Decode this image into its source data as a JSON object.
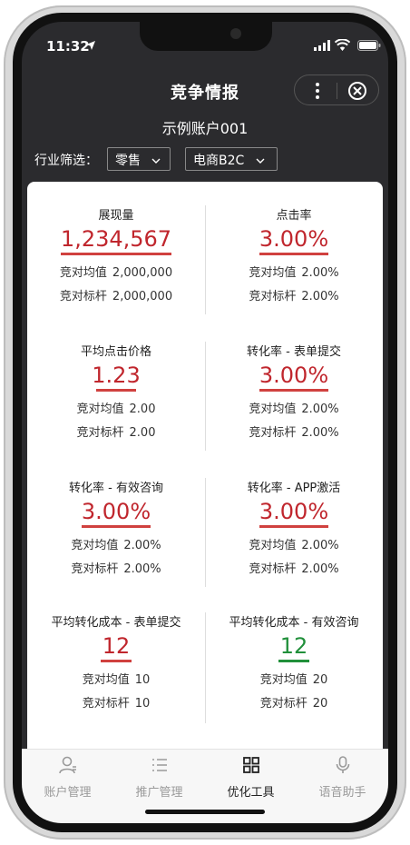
{
  "status_bar": {
    "time": "11:32"
  },
  "header": {
    "title": "竞争情报",
    "account": "示例账户001",
    "filter_label": "行业筛选：",
    "industry_value": "零售",
    "sub_value": "电商B2C"
  },
  "metrics": [
    {
      "title": "展现量",
      "value": "1,234,567",
      "avg_label": "竞对均值",
      "avg": "2,000,000",
      "bench_label": "竞对标杆",
      "bench": "2,000,000",
      "color": "#c0262d"
    },
    {
      "title": "点击率",
      "value": "3.00%",
      "avg_label": "竞对均值",
      "avg": "2.00%",
      "bench_label": "竞对标杆",
      "bench": "2.00%",
      "color": "#c0262d"
    },
    {
      "title": "平均点击价格",
      "value": "1.23",
      "avg_label": "竞对均值",
      "avg": "2.00",
      "bench_label": "竞对标杆",
      "bench": "2.00",
      "color": "#c0262d"
    },
    {
      "title": "转化率 - 表单提交",
      "value": "3.00%",
      "avg_label": "竞对均值",
      "avg": "2.00%",
      "bench_label": "竞对标杆",
      "bench": "2.00%",
      "color": "#c0262d"
    },
    {
      "title": "转化率 - 有效咨询",
      "value": "3.00%",
      "avg_label": "竞对均值",
      "avg": "2.00%",
      "bench_label": "竞对标杆",
      "bench": "2.00%",
      "color": "#c0262d"
    },
    {
      "title": "转化率 - APP激活",
      "value": "3.00%",
      "avg_label": "竞对均值",
      "avg": "2.00%",
      "bench_label": "竞对标杆",
      "bench": "2.00%",
      "color": "#c0262d"
    },
    {
      "title": "平均转化成本 - 表单提交",
      "value": "12",
      "avg_label": "竞对均值",
      "avg": "10",
      "bench_label": "竞对标杆",
      "bench": "10",
      "color": "#c0262d"
    },
    {
      "title": "平均转化成本 - 有效咨询",
      "value": "12",
      "avg_label": "竞对均值",
      "avg": "20",
      "bench_label": "竞对标杆",
      "bench": "20",
      "color": "#21903b"
    }
  ],
  "tabbar": {
    "items": [
      {
        "label": "账户管理",
        "icon": "user-icon"
      },
      {
        "label": "推广管理",
        "icon": "list-icon"
      },
      {
        "label": "优化工具",
        "icon": "grid-icon"
      },
      {
        "label": "语音助手",
        "icon": "microphone-icon"
      }
    ],
    "active": "优化工具"
  }
}
